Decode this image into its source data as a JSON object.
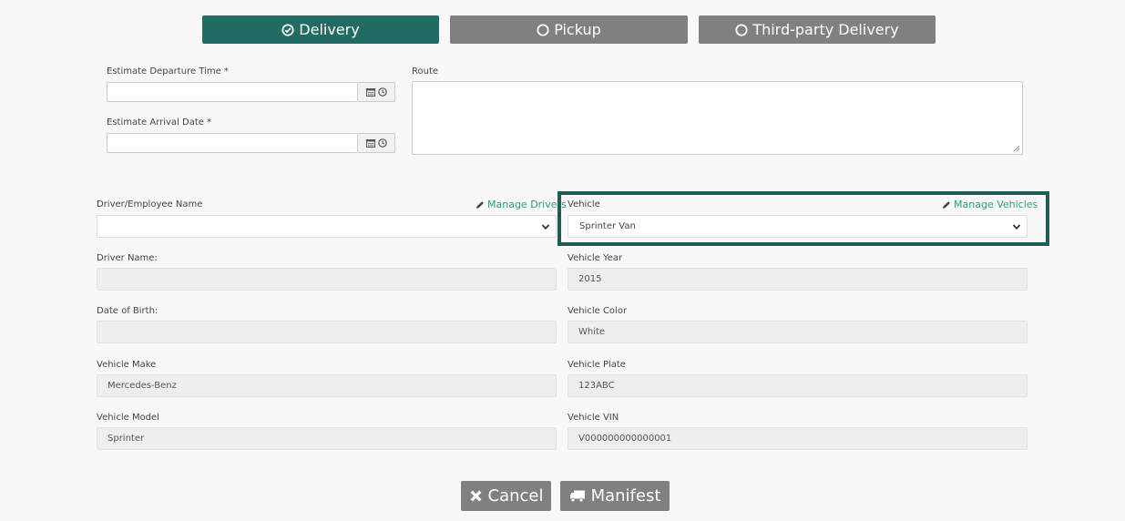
{
  "modes": {
    "delivery": "Delivery",
    "pickup": "Pickup",
    "third_party": "Third-party Delivery"
  },
  "schedule": {
    "departure_label": "Estimate Departure Time *",
    "departure_value": "",
    "arrival_label": "Estimate Arrival Date *",
    "arrival_value": "",
    "route_label": "Route",
    "route_value": ""
  },
  "driver": {
    "label": "Driver/Employee Name",
    "selected": "",
    "manage_link": "Manage Drivers",
    "name_label": "Driver Name:",
    "name_value": "",
    "dob_label": "Date of Birth:",
    "dob_value": ""
  },
  "vehicle": {
    "label": "Vehicle",
    "selected": "Sprinter Van",
    "manage_link": "Manage Vehicles",
    "year_label": "Vehicle Year",
    "year_value": "2015",
    "color_label": "Vehicle Color",
    "color_value": "White",
    "make_label": "Vehicle Make",
    "make_value": "Mercedes-Benz",
    "plate_label": "Vehicle Plate",
    "plate_value": "123ABC",
    "model_label": "Vehicle Model",
    "model_value": "Sprinter",
    "vin_label": "Vehicle VIN",
    "vin_value": "V000000000000001"
  },
  "actions": {
    "cancel": "Cancel",
    "manifest": "Manifest"
  },
  "colors": {
    "accent": "#226b65",
    "inactive": "#808080",
    "link": "#2e9c7e",
    "highlight_border": "#1f5b57"
  },
  "icons": {
    "delivery": "check-circle-icon",
    "pickup": "circle-icon",
    "third_party": "circle-icon",
    "calendar": "calendar-icon",
    "clock": "clock-icon",
    "manage": "pencil-icon",
    "select": "chevron-down-icon",
    "cancel": "times-icon",
    "manifest": "truck-icon"
  }
}
